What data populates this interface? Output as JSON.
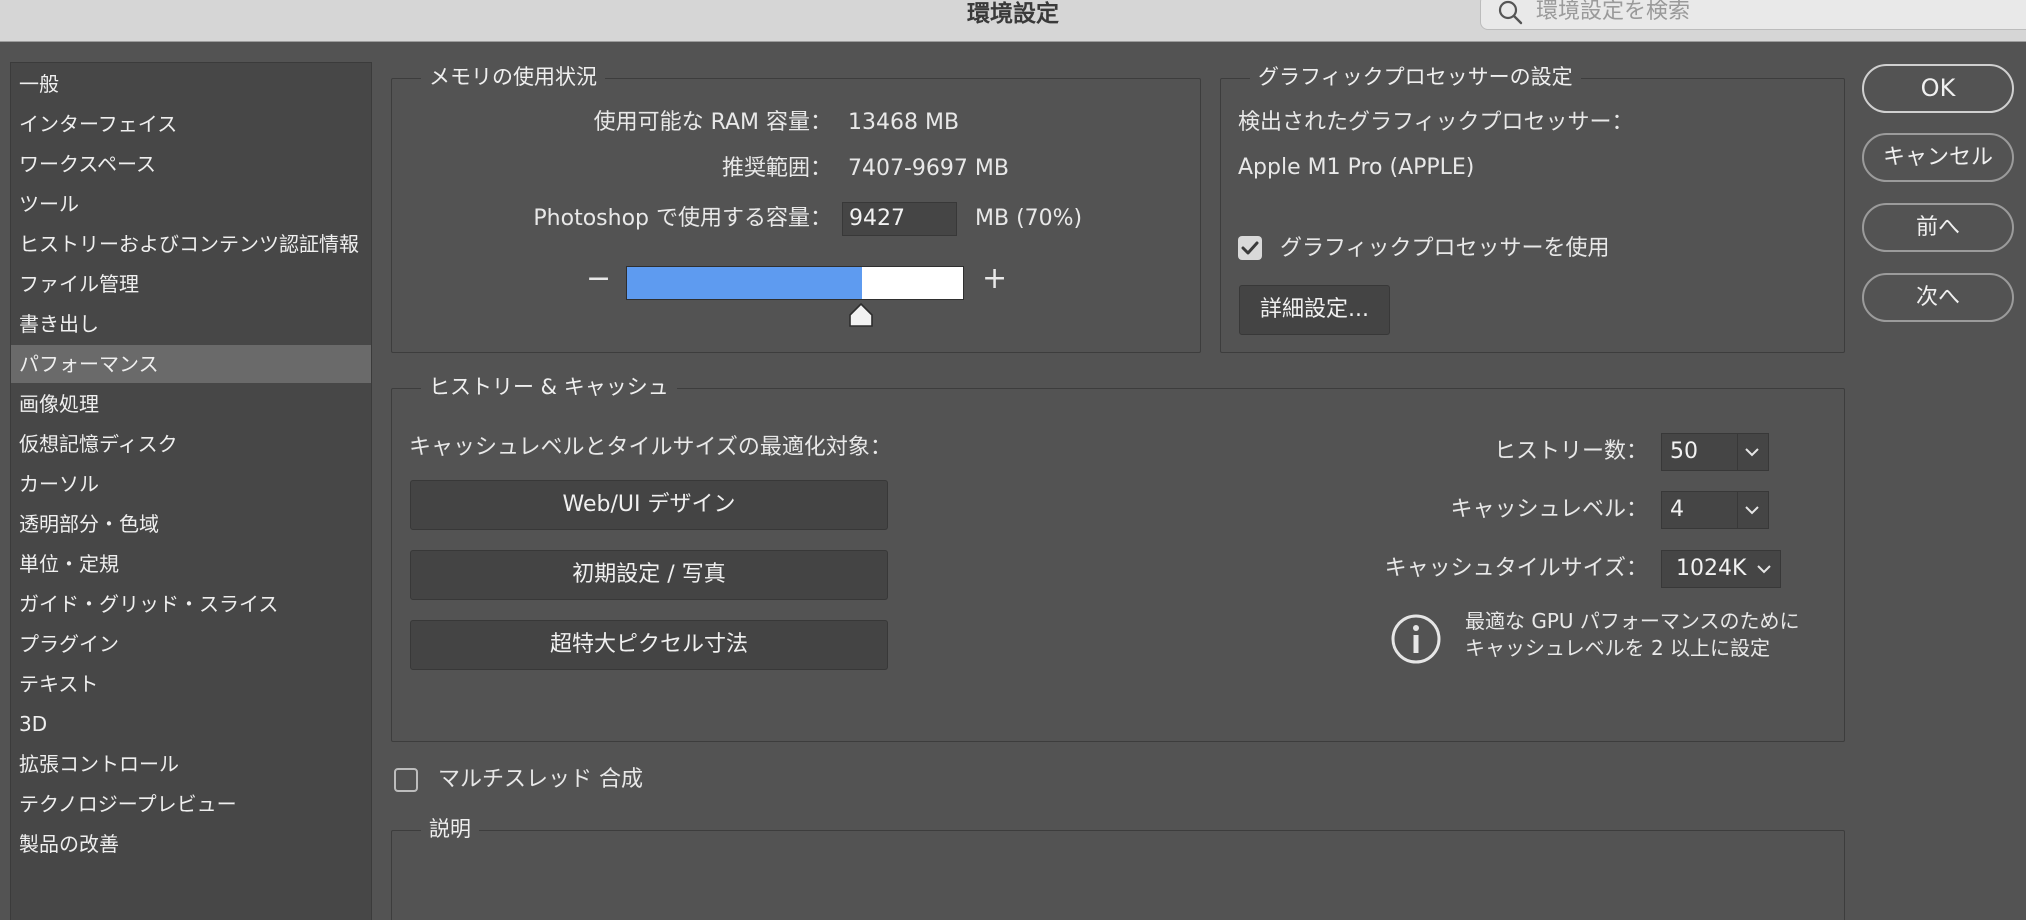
{
  "window": {
    "title": "環境設定"
  },
  "search": {
    "placeholder": "環境設定を検索"
  },
  "sidebar": {
    "items": [
      "一般",
      "インターフェイス",
      "ワークスペース",
      "ツール",
      "ヒストリーおよびコンテンツ認証情報",
      "ファイル管理",
      "書き出し",
      "パフォーマンス",
      "画像処理",
      "仮想記憶ディスク",
      "カーソル",
      "透明部分・色域",
      "単位・定規",
      "ガイド・グリッド・スライス",
      "プラグイン",
      "テキスト",
      "3D",
      "拡張コントロール",
      "テクノロジープレビュー",
      "製品の改善"
    ],
    "selected_index": 7
  },
  "memory": {
    "title": "メモリの使用状況",
    "available_label": "使用可能な RAM 容量：",
    "available_value": "13468 MB",
    "range_label": "推奨範囲：",
    "range_value": "7407-9697 MB",
    "usage_label": "Photoshop で使用する容量：",
    "usage_value": "9427",
    "usage_unit": "MB (70%)",
    "minus": "−",
    "plus": "+",
    "slider_fraction": 0.7
  },
  "gpu": {
    "title": "グラフィックプロセッサーの設定",
    "detected_label": "検出されたグラフィックプロセッサー：",
    "detected_value": "Apple M1 Pro (APPLE)",
    "use_gpu_label": "グラフィックプロセッサーを使用",
    "use_gpu_checked": true,
    "advanced_button": "詳細設定..."
  },
  "history_cache": {
    "title": "ヒストリー & キャッシュ",
    "optimize_label": "キャッシュレベルとタイルサイズの最適化対象：",
    "buttons": [
      "Web/UI デザイン",
      "初期設定 / 写真",
      "超特大ピクセル寸法"
    ],
    "history_states_label": "ヒストリー数：",
    "history_states_value": "50",
    "cache_levels_label": "キャッシュレベル：",
    "cache_levels_value": "4",
    "tile_size_label": "キャッシュタイルサイズ：",
    "tile_size_value": "1024K",
    "info_line1": "最適な GPU パフォーマンスのために",
    "info_line2": "キャッシュレベルを 2 以上に設定"
  },
  "multithread": {
    "label": "マルチスレッド 合成",
    "checked": false
  },
  "description": {
    "title": "説明"
  },
  "actions": {
    "ok": "OK",
    "cancel": "キャンセル",
    "prev": "前へ",
    "next": "次へ"
  },
  "colors": {
    "slider_fill": "#5e9bf0",
    "panel_bg": "#535353",
    "selected_item": "#6a6a6a"
  }
}
